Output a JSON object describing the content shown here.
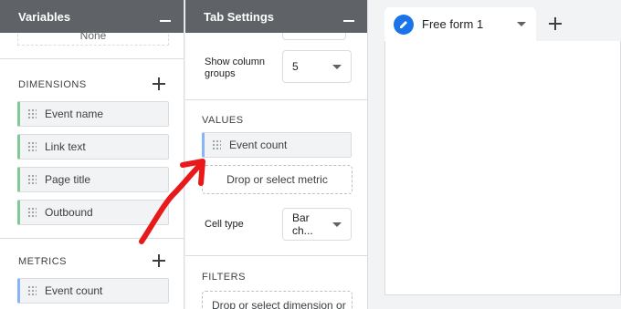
{
  "variables_panel": {
    "title": "Variables",
    "top_button": "None",
    "dimensions": {
      "title": "DIMENSIONS",
      "items": [
        "Event name",
        "Link text",
        "Page title",
        "Outbound"
      ]
    },
    "metrics": {
      "title": "METRICS",
      "items": [
        "Event count"
      ]
    }
  },
  "tab_settings": {
    "title": "Tab Settings",
    "show_column_groups": {
      "label_line1": "Show column",
      "label_line2": "groups",
      "value": "5"
    },
    "values": {
      "title": "VALUES",
      "items": [
        "Event count"
      ],
      "dropzone": "Drop or select metric"
    },
    "cell_type": {
      "label": "Cell type",
      "value": "Bar ch..."
    },
    "filters": {
      "title": "FILTERS",
      "dropzone": "Drop or select dimension or"
    }
  },
  "canvas": {
    "tab_label": "Free form 1"
  },
  "colors": {
    "header_bg": "#5f6368",
    "dimension_accent": "#81c995",
    "metric_accent": "#8ab4f8",
    "tab_icon": "#1a73e8",
    "annotation_arrow": "#e8191b"
  },
  "icons": [
    "minimize-icon",
    "plus-icon",
    "drag-handle-icon",
    "dropdown-caret-icon",
    "pencil-icon",
    "annotation-arrow"
  ]
}
